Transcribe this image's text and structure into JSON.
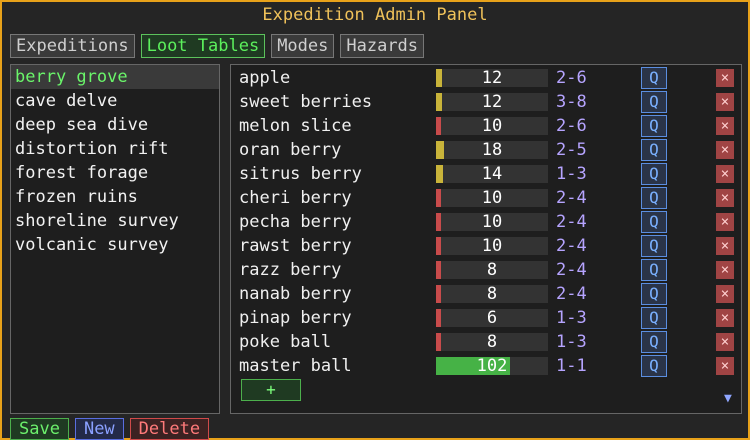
{
  "window": {
    "title": "Expedition Admin Panel"
  },
  "tabs": [
    {
      "label": "Expeditions",
      "active": false
    },
    {
      "label": "Loot Tables",
      "active": true
    },
    {
      "label": "Modes",
      "active": false
    },
    {
      "label": "Hazards",
      "active": false
    }
  ],
  "loot_tables": [
    "berry grove",
    "cave delve",
    "deep sea dive",
    "distortion rift",
    "forest forage",
    "frozen ruins",
    "shoreline survey",
    "volcanic survey"
  ],
  "selected_table": "berry grove",
  "entries": [
    {
      "name": "apple",
      "weight": "12",
      "weight_fraction": 0.05,
      "range": "2-6",
      "color": "#c9b43a"
    },
    {
      "name": "sweet berries",
      "weight": "12",
      "weight_fraction": 0.05,
      "range": "3-8",
      "color": "#c9b43a"
    },
    {
      "name": "melon slice",
      "weight": "10",
      "weight_fraction": 0.04,
      "range": "2-6",
      "color": "#c84b4b"
    },
    {
      "name": "oran berry",
      "weight": "18",
      "weight_fraction": 0.07,
      "range": "2-5",
      "color": "#c9b43a"
    },
    {
      "name": "sitrus berry",
      "weight": "14",
      "weight_fraction": 0.06,
      "range": "1-3",
      "color": "#c9b43a"
    },
    {
      "name": "cheri berry",
      "weight": "10",
      "weight_fraction": 0.04,
      "range": "2-4",
      "color": "#c84b4b"
    },
    {
      "name": "pecha berry",
      "weight": "10",
      "weight_fraction": 0.04,
      "range": "2-4",
      "color": "#c84b4b"
    },
    {
      "name": "rawst berry",
      "weight": "10",
      "weight_fraction": 0.04,
      "range": "2-4",
      "color": "#c84b4b"
    },
    {
      "name": "razz berry",
      "weight": "8",
      "weight_fraction": 0.03,
      "range": "2-4",
      "color": "#c84b4b"
    },
    {
      "name": "nanab berry",
      "weight": "8",
      "weight_fraction": 0.03,
      "range": "2-4",
      "color": "#c84b4b"
    },
    {
      "name": "pinap berry",
      "weight": "6",
      "weight_fraction": 0.03,
      "range": "1-3",
      "color": "#c84b4b"
    },
    {
      "name": "poke ball",
      "weight": "8",
      "weight_fraction": 0.03,
      "range": "1-3",
      "color": "#c84b4b"
    },
    {
      "name": "master ball",
      "weight": "102",
      "weight_fraction": 0.66,
      "range": "1-1",
      "color": "#46b246"
    }
  ],
  "row_controls": {
    "q_label": "Q",
    "x_label": "×"
  },
  "add_label": "+",
  "scroll": {
    "up_icon": "▲",
    "down_icon": "▼"
  },
  "bottom_buttons": {
    "save": "Save",
    "new": "New",
    "delete": "Delete"
  }
}
